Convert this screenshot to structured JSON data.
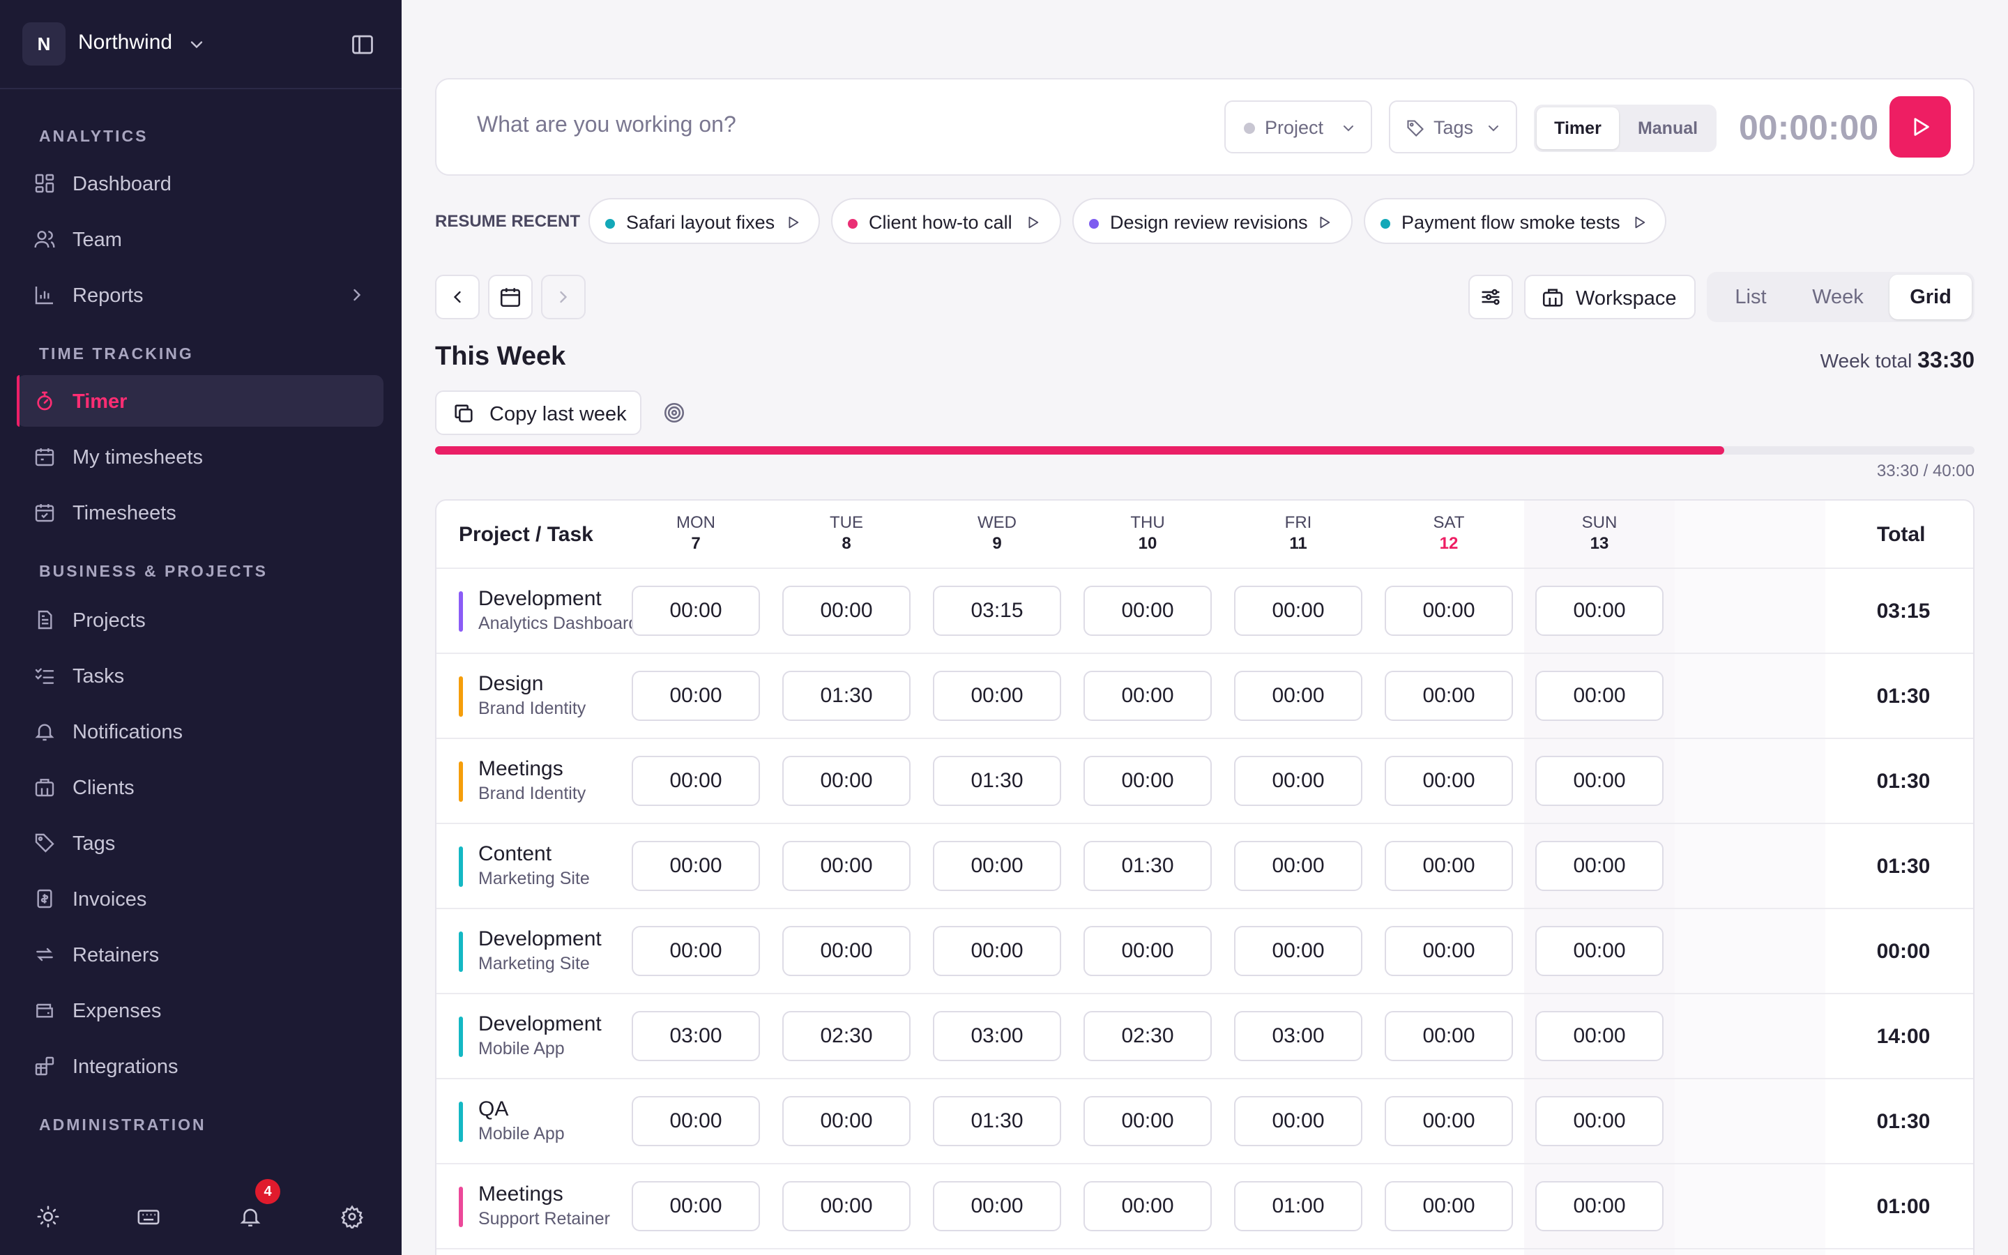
{
  "workspace": {
    "initial": "N",
    "name": "Northwind"
  },
  "sidebar": {
    "sections": [
      {
        "title": "ANALYTICS",
        "items": [
          {
            "label": "Dashboard",
            "icon": "dashboard-icon"
          },
          {
            "label": "Team",
            "icon": "team-icon"
          },
          {
            "label": "Reports",
            "icon": "reports-icon",
            "expandable": true
          }
        ]
      },
      {
        "title": "TIME TRACKING",
        "items": [
          {
            "label": "Timer",
            "icon": "stopwatch-icon",
            "active": true
          },
          {
            "label": "My timesheets",
            "icon": "calendar-icon"
          },
          {
            "label": "Timesheets",
            "icon": "calendar-check-icon"
          }
        ]
      },
      {
        "title": "BUSINESS & PROJECTS",
        "items": [
          {
            "label": "Projects",
            "icon": "document-icon"
          },
          {
            "label": "Tasks",
            "icon": "checklist-icon"
          },
          {
            "label": "Notifications",
            "icon": "bell-icon"
          },
          {
            "label": "Clients",
            "icon": "building-icon"
          },
          {
            "label": "Tags",
            "icon": "tag-icon"
          },
          {
            "label": "Invoices",
            "icon": "invoice-icon"
          },
          {
            "label": "Retainers",
            "icon": "repeat-icon"
          },
          {
            "label": "Expenses",
            "icon": "wallet-icon"
          },
          {
            "label": "Integrations",
            "icon": "puzzle-icon"
          }
        ]
      },
      {
        "title": "ADMINISTRATION",
        "items": []
      }
    ],
    "bottom": {
      "notification_count": "4"
    }
  },
  "timer": {
    "placeholder": "What are you working on?",
    "project_label": "Project",
    "tags_label": "Tags",
    "modes": [
      "Timer",
      "Manual"
    ],
    "active_mode": "Timer",
    "elapsed": "00:00:00"
  },
  "resume": {
    "label": "RESUME RECENT",
    "items": [
      {
        "label": "Safari layout fixes",
        "color": "#13a8b8"
      },
      {
        "label": "Client how-to call",
        "color": "#ea2e74"
      },
      {
        "label": "Design review revisions",
        "color": "#7d5cf0"
      },
      {
        "label": "Payment flow smoke tests",
        "color": "#13a8b8"
      }
    ]
  },
  "toolbar": {
    "scope_label": "Workspace",
    "views": [
      "List",
      "Week",
      "Grid"
    ],
    "active_view": "Grid"
  },
  "week": {
    "title": "This Week",
    "total_label": "Week total",
    "total": "33:30",
    "copy_label": "Copy last week",
    "progress_text": "33:30 / 40:00",
    "progress_fraction": 0.8375
  },
  "grid": {
    "header_task": "Project / Task",
    "header_total": "Total",
    "days": [
      {
        "name": "MON",
        "date": "7"
      },
      {
        "name": "TUE",
        "date": "8"
      },
      {
        "name": "WED",
        "date": "9"
      },
      {
        "name": "THU",
        "date": "10"
      },
      {
        "name": "FRI",
        "date": "11"
      },
      {
        "name": "SAT",
        "date": "12",
        "today": true
      },
      {
        "name": "SUN",
        "date": "13"
      }
    ],
    "rows": [
      {
        "task": "Development",
        "project": "Analytics Dashboard",
        "color": "#8b5cf6",
        "hours": [
          "00:00",
          "00:00",
          "03:15",
          "00:00",
          "00:00",
          "00:00",
          "00:00"
        ],
        "total": "03:15"
      },
      {
        "task": "Design",
        "project": "Brand Identity",
        "color": "#f59e0b",
        "hours": [
          "00:00",
          "01:30",
          "00:00",
          "00:00",
          "00:00",
          "00:00",
          "00:00"
        ],
        "total": "01:30"
      },
      {
        "task": "Meetings",
        "project": "Brand Identity",
        "color": "#f59e0b",
        "hours": [
          "00:00",
          "00:00",
          "01:30",
          "00:00",
          "00:00",
          "00:00",
          "00:00"
        ],
        "total": "01:30"
      },
      {
        "task": "Content",
        "project": "Marketing Site",
        "color": "#14b8c4",
        "hours": [
          "00:00",
          "00:00",
          "00:00",
          "01:30",
          "00:00",
          "00:00",
          "00:00"
        ],
        "total": "01:30"
      },
      {
        "task": "Development",
        "project": "Marketing Site",
        "color": "#14b8c4",
        "hours": [
          "00:00",
          "00:00",
          "00:00",
          "00:00",
          "00:00",
          "00:00",
          "00:00"
        ],
        "total": "00:00"
      },
      {
        "task": "Development",
        "project": "Mobile App",
        "color": "#14b8c4",
        "hours": [
          "03:00",
          "02:30",
          "03:00",
          "02:30",
          "03:00",
          "00:00",
          "00:00"
        ],
        "total": "14:00"
      },
      {
        "task": "QA",
        "project": "Mobile App",
        "color": "#14b8c4",
        "hours": [
          "00:00",
          "00:00",
          "01:30",
          "00:00",
          "00:00",
          "00:00",
          "00:00"
        ],
        "total": "01:30"
      },
      {
        "task": "Meetings",
        "project": "Support Retainer",
        "color": "#ec4899",
        "hours": [
          "00:00",
          "00:00",
          "00:00",
          "00:00",
          "01:00",
          "00:00",
          "00:00"
        ],
        "total": "01:00"
      }
    ]
  }
}
